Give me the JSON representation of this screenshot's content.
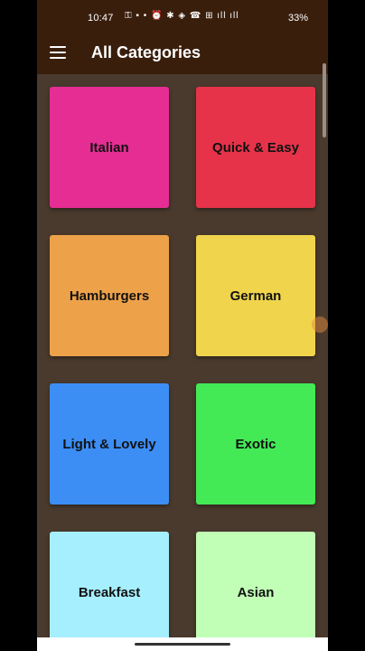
{
  "status": {
    "time": "10:47",
    "icons": "⚿ ▪ • ⏰ ✱ ◈ ☎ ⊞ ıll ıll",
    "battery": "33%"
  },
  "app_bar": {
    "title": "All Categories",
    "menu_icon": "hamburger-menu-icon"
  },
  "categories": [
    {
      "label": "Italian",
      "color": "#e52d94"
    },
    {
      "label": "Quick & Easy",
      "color": "#e6334a"
    },
    {
      "label": "Hamburgers",
      "color": "#eda24a"
    },
    {
      "label": "German",
      "color": "#f0d44c"
    },
    {
      "label": "Light & Lovely",
      "color": "#3c8ef5"
    },
    {
      "label": "Exotic",
      "color": "#43ea55"
    },
    {
      "label": "Breakfast",
      "color": "#a6efff"
    },
    {
      "label": "Asian",
      "color": "#c0ffb5"
    }
  ]
}
